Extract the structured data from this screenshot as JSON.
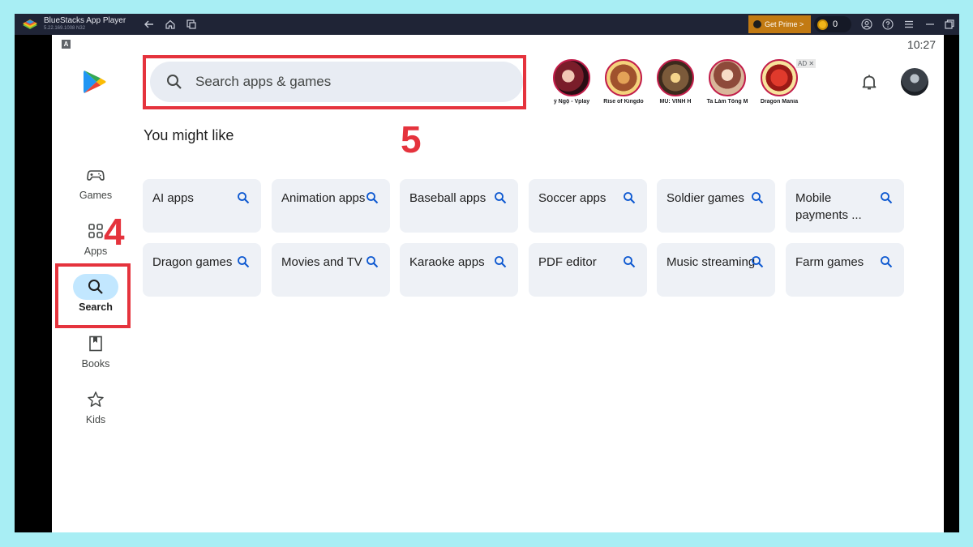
{
  "titlebar": {
    "app_name": "BlueStacks App Player",
    "version": "5.22.169.1008  N32",
    "get_prime": "Get Prime >",
    "coins": "0"
  },
  "status": {
    "indicator": "A",
    "time": "10:27"
  },
  "search": {
    "placeholder": "Search apps & games"
  },
  "annotations": {
    "step4": "4",
    "step5": "5",
    "color": "#e5333d"
  },
  "promos": [
    {
      "label": "ý Ngộ - Vplay"
    },
    {
      "label": "Rise of Kingdo"
    },
    {
      "label": "MU: VĨNH H"
    },
    {
      "label": "Ta Làm Tông M"
    },
    {
      "label": "Dragon Mania"
    }
  ],
  "ad_badge": "AD ✕",
  "section_title": "You might like",
  "nav": [
    {
      "label": "Games",
      "icon": "gamepad-icon"
    },
    {
      "label": "Apps",
      "icon": "apps-grid-icon"
    },
    {
      "label": "Search",
      "icon": "search-icon"
    },
    {
      "label": "Books",
      "icon": "bookmark-icon"
    },
    {
      "label": "Kids",
      "icon": "star-icon"
    }
  ],
  "chips": [
    {
      "label": "AI apps"
    },
    {
      "label": "Animation apps"
    },
    {
      "label": "Baseball apps"
    },
    {
      "label": "Soccer apps"
    },
    {
      "label": "Soldier games"
    },
    {
      "label": "Mobile payments ..."
    },
    {
      "label": "Dragon games"
    },
    {
      "label": "Movies and TV"
    },
    {
      "label": "Karaoke apps"
    },
    {
      "label": "PDF editor"
    },
    {
      "label": "Music streaming"
    },
    {
      "label": "Farm games"
    }
  ],
  "colors": {
    "accent": "#0b57d0",
    "nav_active": "#c2e7ff",
    "chip_bg": "#eef1f6",
    "titlebar": "#1f2436"
  }
}
